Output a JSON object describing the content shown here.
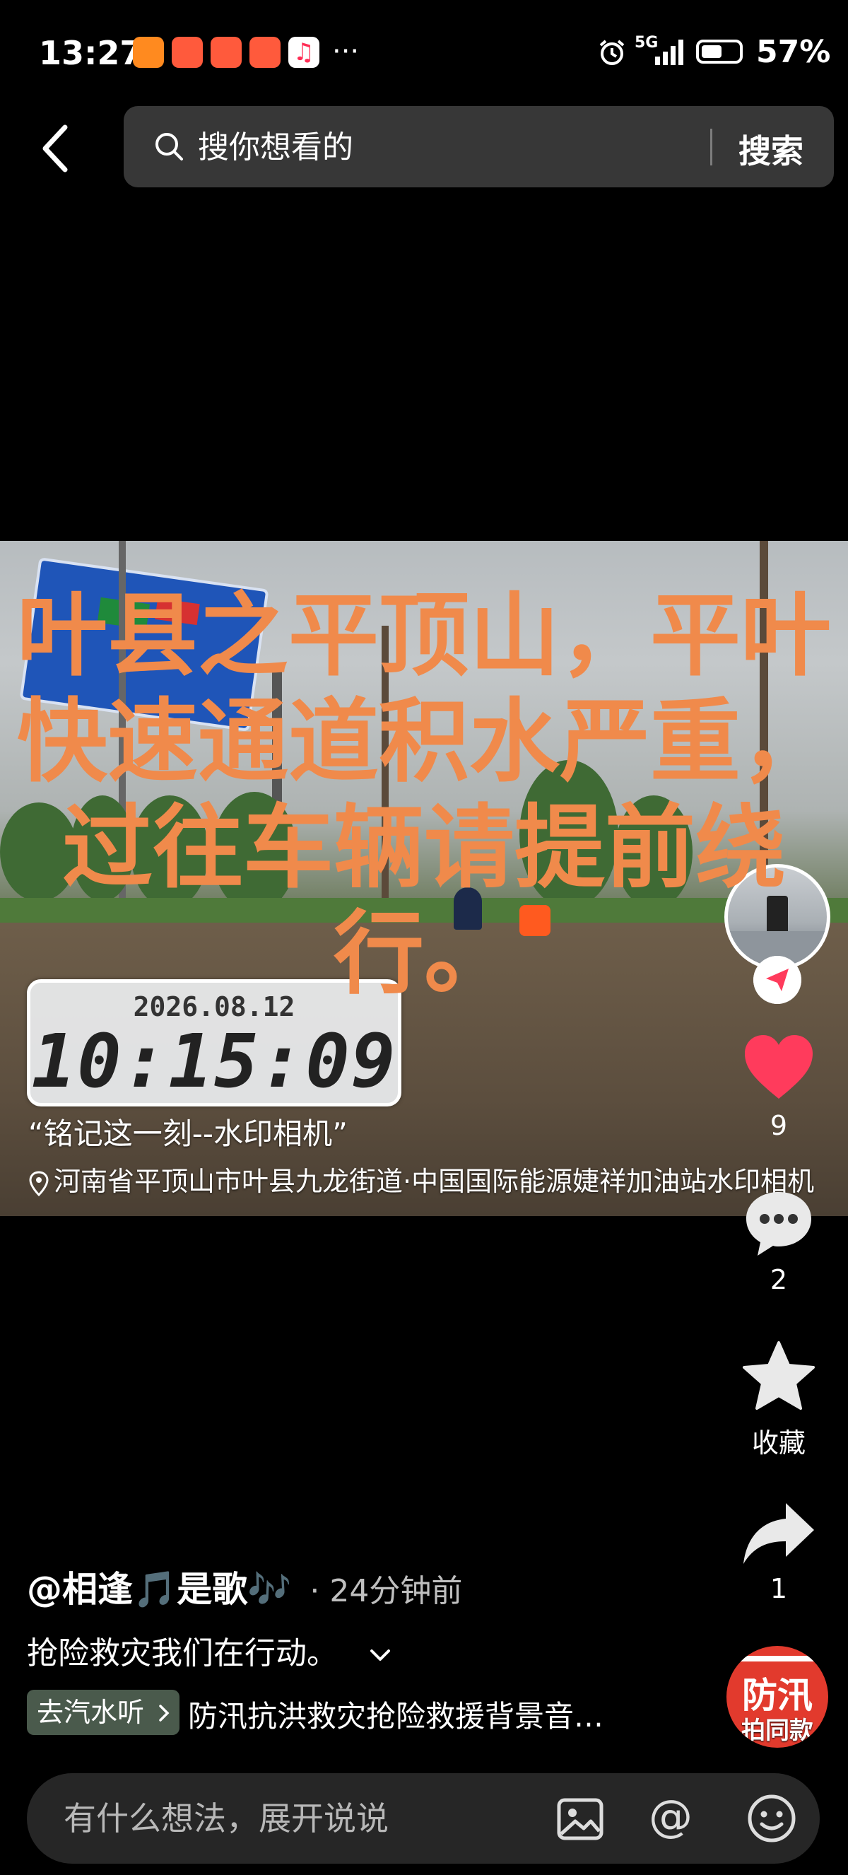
{
  "status_bar": {
    "time": "13:27",
    "network": "5G",
    "battery": "57%",
    "battery_level": 0.57,
    "overflow": "···"
  },
  "search": {
    "placeholder": "搜你想看的",
    "button_label": "搜索"
  },
  "video": {
    "caption": "叶县之平顶山，平叶快速通道积水严重，过往车辆请提前绕行。",
    "watermark": {
      "date": "2026.08.12",
      "time": "10:15:09",
      "slogan": "“铭记这一刻--水印相机”",
      "location": "河南省平顶山市叶县九龙街道·中国国际能源婕祥加油站水印相机"
    }
  },
  "actions": {
    "like_count": "9",
    "comment_count": "2",
    "favorite_label": "收藏",
    "share_count": "1",
    "template_top": "防汛",
    "template_bottom": "拍同款"
  },
  "post": {
    "author": "@相逢🎵是歌🎶",
    "time": "· 24分钟前",
    "description": "抢险救灾我们在行动。",
    "music_tag": "去汽水听",
    "music_title": "防汛抗洪救灾抢险救援背景音…"
  },
  "comment_bar": {
    "placeholder": "有什么想法，展开说说"
  },
  "colors": {
    "caption": "#f08a4b",
    "like": "#ff3b5c",
    "accent_red": "#e23a2d",
    "music_tag_bg": "#4a5a4c"
  }
}
